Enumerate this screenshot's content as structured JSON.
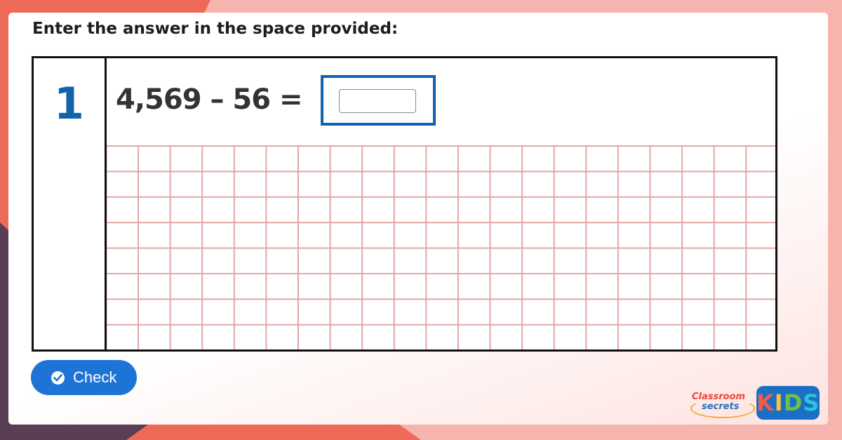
{
  "instruction": "Enter the answer in the space provided:",
  "question": {
    "number": "1",
    "equation": "4,569 – 56 =",
    "answer_value": "",
    "answer_placeholder": ""
  },
  "check_button": {
    "label": "Check"
  },
  "branding": {
    "classroom_top": "Classroom",
    "classroom_bottom": "secrets",
    "kids_letters": [
      "K",
      "I",
      "D",
      "S"
    ]
  },
  "colors": {
    "accent_blue": "#1262ac",
    "button_blue": "#1e74d6",
    "grid_line": "#e0a9a6",
    "background_pink": "#f6b4ae",
    "background_coral": "#ee6a58",
    "background_purple": "#5a3e56"
  },
  "icons": {
    "check_button_icon": "check-circle-icon"
  }
}
